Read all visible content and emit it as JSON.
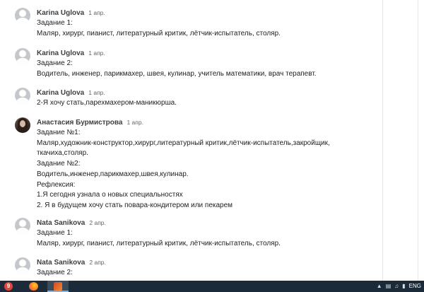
{
  "comments": [
    {
      "author": "Karina Uglova",
      "date": "1 апр.",
      "avatar": "default",
      "lines": [
        "Задание 1:",
        "Маляр, хирург, пианист, литературный критик, лётчик-испытатель, столяр."
      ]
    },
    {
      "author": "Karina Uglova",
      "date": "1 апр.",
      "avatar": "default",
      "lines": [
        "Задание 2:",
        "Водитель, инженер, парикмахер, швея, кулинар, учитель математики, врач терапевт."
      ]
    },
    {
      "author": "Karina Uglova",
      "date": "1 апр.",
      "avatar": "default",
      "lines": [
        "2-Я хочу стать,парехмахером-маникюрша."
      ]
    },
    {
      "author": "Анастасия Бурмистрова",
      "date": "1 апр.",
      "avatar": "photo",
      "lines": [
        "Задание №1:",
        "Маляр,художник-конструктор,хирург,литературный критик,лётчик-испытатель,закройщик,",
        "ткачиха,столяр.",
        "Задание №2:",
        "Водитель,инженер,парикмахер,швея,кулинар.",
        "Рефлексия:",
        "1.Я сегодня узнала о новых специальностях",
        "2. Я в будущем хочу стать повара-кондитером или пекарем"
      ]
    },
    {
      "author": "Nata Sanikova",
      "date": "2 апр.",
      "avatar": "default",
      "lines": [
        "Задание 1:",
        "Маляр, хирург, пианист, литературный критик, лётчик-испытатель, столяр."
      ]
    },
    {
      "author": "Nata Sanikova",
      "date": "2 апр.",
      "avatar": "default",
      "lines": [
        "Задание 2:"
      ]
    }
  ],
  "taskbar": {
    "chrome_badge": "9",
    "tray_language": "ENG",
    "icons": [
      "chrome-icon",
      "firefox-icon",
      "active-app-icon",
      "chevron-up-icon",
      "network-icon",
      "volume-icon",
      "battery-icon"
    ]
  }
}
